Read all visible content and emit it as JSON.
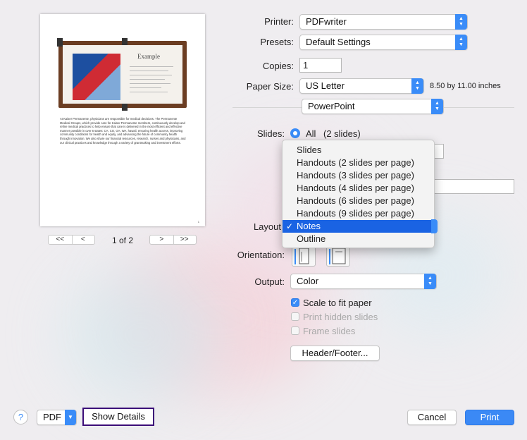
{
  "printer": {
    "label": "Printer:",
    "value": "PDFwriter"
  },
  "presets": {
    "label": "Presets:",
    "value": "Default Settings"
  },
  "copies": {
    "label": "Copies:",
    "value": "1"
  },
  "paper_size": {
    "label": "Paper Size:",
    "value": "US Letter",
    "dimensions": "8.50 by 11.00 inches"
  },
  "app_section": {
    "value": "PowerPoint"
  },
  "slides": {
    "label": "Slides:",
    "option": "All",
    "count": "(2 slides)"
  },
  "layout": {
    "label": "Layout",
    "options": [
      "Slides",
      "Handouts (2 slides per page)",
      "Handouts (3 slides per page)",
      "Handouts (4 slides per page)",
      "Handouts (6 slides per page)",
      "Handouts (9 slides per page)",
      "Notes",
      "Outline"
    ],
    "selected": "Notes",
    "checkmark": "✓"
  },
  "orientation": {
    "label": "Orientation:"
  },
  "output": {
    "label": "Output:",
    "value": "Color"
  },
  "options": {
    "scale": {
      "label": "Scale to fit paper",
      "checked": true
    },
    "hidden": {
      "label": "Print hidden slides",
      "checked": false
    },
    "frame": {
      "label": "Frame slides",
      "checked": false
    }
  },
  "header_footer_button": "Header/Footer...",
  "preview": {
    "page_indicator": "1 of 2",
    "slide_title": "Example",
    "notes_text": "At Kaiser Permanente, physicians are responsible for medical decisions. The Permanente Medical Groups, which provide care for Kaiser Permanente members, continuously develop and refine medical practices to help ensure that care is delivered in the most efficient and effective manner possible in over 6 states: CA, CO, GA, WA, hawaii, ensuring health access, improving community conditions for health and equity, and advancing the future of community health through innovation. We also share our financial resources, research, nurses and physicians, and our clinical practices and knowledge through a variety of grantmaking and investment efforts.",
    "page_number": "1",
    "first_label": "<<",
    "prev_label": "<",
    "next_label": ">",
    "last_label": ">>"
  },
  "bottom": {
    "help": "?",
    "pdf": "PDF",
    "show_details": "Show Details",
    "cancel": "Cancel",
    "print": "Print"
  },
  "colors": {
    "accent": "#3a8cf8",
    "selection": "#1a63e3",
    "highlight_box": "#3b0d78"
  }
}
